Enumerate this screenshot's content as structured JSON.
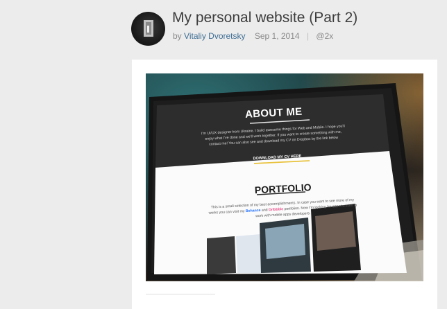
{
  "post": {
    "title": "My personal website (Part 2)",
    "by": "by",
    "author": "Vitaliy Dvoretsky",
    "date": "Sep 1, 2014",
    "separator": "|",
    "resolution": "@2x"
  },
  "screen": {
    "about_heading": "ABOUT ME",
    "about_text_1": "I'm UI/UX designer from Ukraine. I build awesome things for Web and Mobile. I hope you'll",
    "about_text_2": "enjoy what I've done and we'll work together. If you want to create something with me,",
    "about_text_3": "contact me! You can also see and download my CV on Dropbox by the link below",
    "cv_button": "DOWNLOAD MY CV HERE",
    "portfolio_heading": "PORTFOLIO",
    "portfolio_text_1": "This is a small selection of my best accomplishments. In case you want to see more of my",
    "portfolio_text_2a": "works you can visit my",
    "portfolio_behance": "Behance",
    "portfolio_and": "and",
    "portfolio_dribbble": "Dribbble",
    "portfolio_text_2b": "portfolios. Now I'm looking for opportunities to",
    "portfolio_text_3": "work with mobile apps developers."
  },
  "colors": {
    "author_link": "#3f6e94",
    "behance_link": "#1769ff",
    "dribbble_link": "#ea4c89",
    "cv_underline": "#e8c23c"
  },
  "icons": {
    "avatar": "avatar-photo"
  }
}
